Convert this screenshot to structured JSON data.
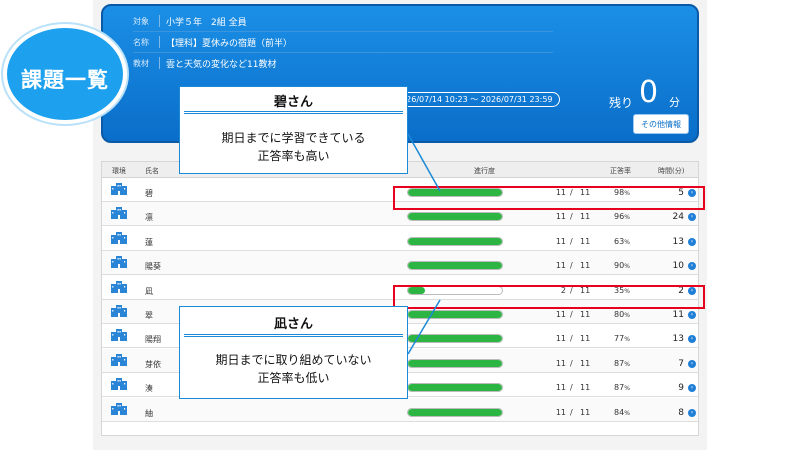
{
  "badge": {
    "label": "課題一覧"
  },
  "assignment": {
    "target_key": "対象",
    "target_value": "小学５年　2組 全員",
    "name_key": "名称",
    "name_value": "【理科】夏休みの宿題（前半）",
    "material_key": "教材",
    "material_value": "雲と天気の変化など11教材",
    "period": "2026/07/14 10:23 〜 2026/07/31 23:59",
    "remaining_label": "残り",
    "remaining_value": "0",
    "remaining_unit": "分",
    "other_info_button": "その他情報"
  },
  "table": {
    "headers": {
      "env": "環境",
      "name": "氏名",
      "progress": "進行度",
      "rate": "正答率",
      "time": "時間(分)"
    },
    "slash": "/",
    "percent_unit": "%",
    "rows": [
      {
        "name": "碧",
        "done": "11",
        "total": "11",
        "progress": 1.0,
        "rate": "98",
        "minutes": "5"
      },
      {
        "name": "凛",
        "done": "11",
        "total": "11",
        "progress": 1.0,
        "rate": "96",
        "minutes": "24"
      },
      {
        "name": "蓮",
        "done": "11",
        "total": "11",
        "progress": 1.0,
        "rate": "63",
        "minutes": "13"
      },
      {
        "name": "陽葵",
        "done": "11",
        "total": "11",
        "progress": 1.0,
        "rate": "90",
        "minutes": "10"
      },
      {
        "name": "凪",
        "done": "2",
        "total": "11",
        "progress": 0.18,
        "rate": "35",
        "minutes": "2"
      },
      {
        "name": "翠",
        "done": "11",
        "total": "11",
        "progress": 1.0,
        "rate": "80",
        "minutes": "11"
      },
      {
        "name": "陽翔",
        "done": "11",
        "total": "11",
        "progress": 1.0,
        "rate": "77",
        "minutes": "13"
      },
      {
        "name": "芽依",
        "done": "11",
        "total": "11",
        "progress": 1.0,
        "rate": "87",
        "minutes": "7"
      },
      {
        "name": "湊",
        "done": "11",
        "total": "11",
        "progress": 1.0,
        "rate": "87",
        "minutes": "9"
      },
      {
        "name": "紬",
        "done": "11",
        "total": "11",
        "progress": 1.0,
        "rate": "84",
        "minutes": "8"
      }
    ]
  },
  "callouts": {
    "aoi": {
      "title": "碧さん",
      "line1": "期日までに学習できている",
      "line2": "正答率も高い"
    },
    "nagi": {
      "title": "凪さん",
      "line1": "期日までに取り組めていない",
      "line2": "正答率も低い"
    }
  },
  "colors": {
    "header_blue": "#0a6ec9",
    "bar_green": "#2db543",
    "highlight_red": "#e8001f",
    "badge_blue": "#1da1ee"
  },
  "icons": {
    "env": "school-building-icon",
    "detail": "arrow-circle-icon"
  }
}
